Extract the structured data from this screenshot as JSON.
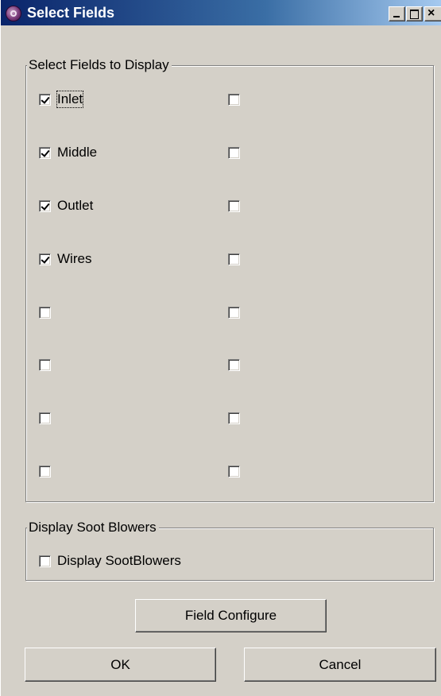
{
  "window": {
    "title": "Select Fields",
    "icon": "app-icon",
    "controls": {
      "minimize": "minimize-icon",
      "maximize": "maximize-icon",
      "close": "×"
    }
  },
  "fields_group": {
    "legend": "Select Fields to Display",
    "left_column": [
      {
        "label": "Inlet",
        "checked": true
      },
      {
        "label": "Middle",
        "checked": true
      },
      {
        "label": "Outlet",
        "checked": true
      },
      {
        "label": "Wires",
        "checked": true
      },
      {
        "label": "",
        "checked": false
      },
      {
        "label": "",
        "checked": false
      },
      {
        "label": "",
        "checked": false
      },
      {
        "label": "",
        "checked": false
      }
    ],
    "right_column": [
      {
        "label": "",
        "checked": false
      },
      {
        "label": "",
        "checked": false
      },
      {
        "label": "",
        "checked": false
      },
      {
        "label": "",
        "checked": false
      },
      {
        "label": "",
        "checked": false
      },
      {
        "label": "",
        "checked": false
      },
      {
        "label": "",
        "checked": false
      },
      {
        "label": "",
        "checked": false
      }
    ]
  },
  "soot_group": {
    "legend": "Display Soot Blowers",
    "checkbox": {
      "label": "Display SootBlowers",
      "checked": false
    }
  },
  "buttons": {
    "field_configure": "Field Configure",
    "ok": "OK",
    "cancel": "Cancel"
  }
}
